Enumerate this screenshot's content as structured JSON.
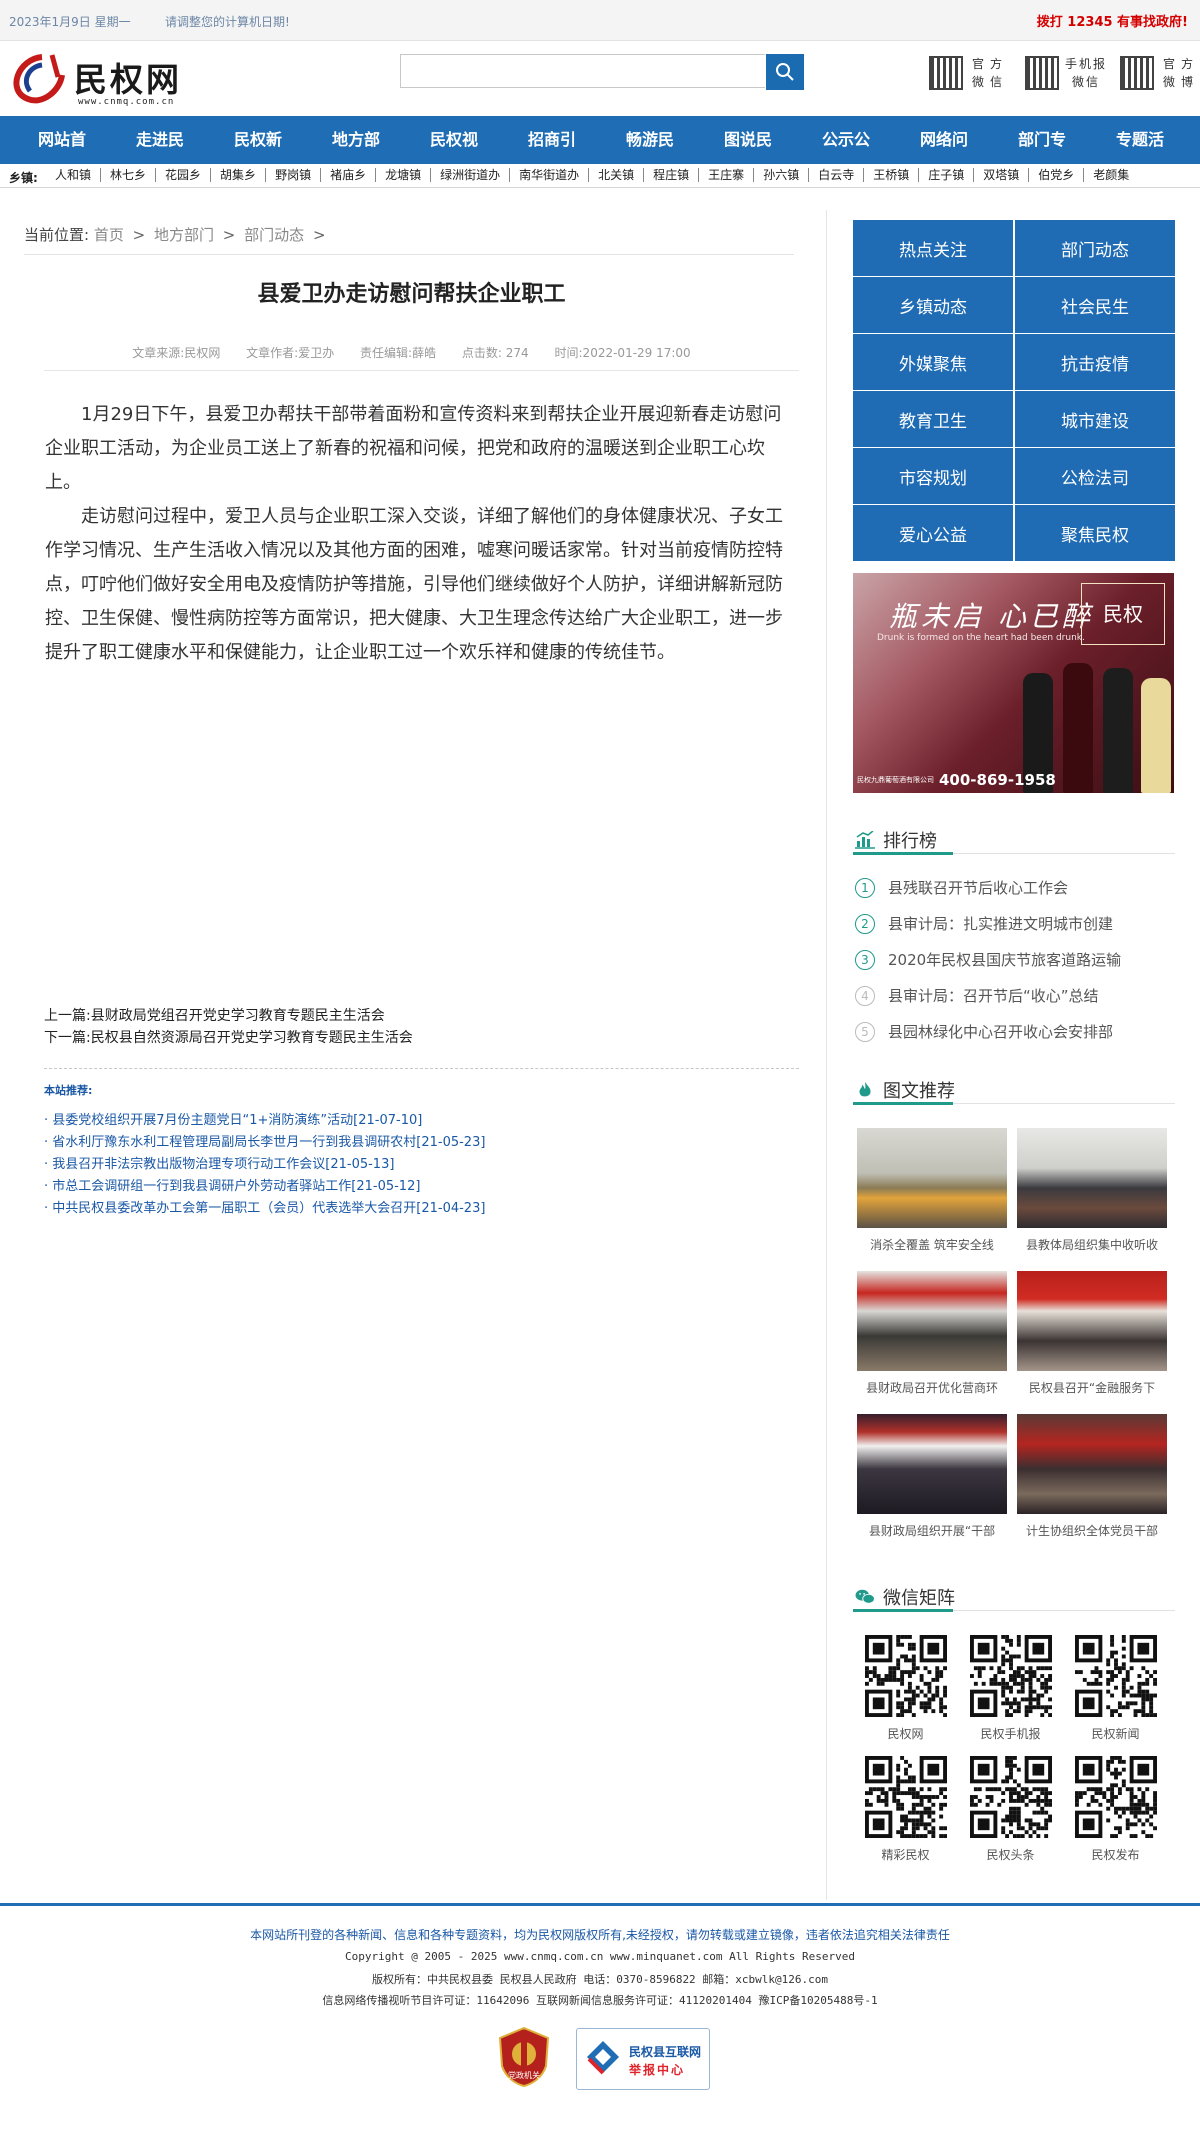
{
  "topbar": {
    "date": "2023年1月9日  星期一",
    "notice": "请调整您的计算机日期!",
    "hotline": "拨打 12345 有事找政府!"
  },
  "header": {
    "logo_text": "民权网",
    "logo_url": "www.cnmq.com.cn",
    "search_placeholder": "",
    "qr_links": [
      {
        "label": "官方微信"
      },
      {
        "label": "手机报微信"
      },
      {
        "label": "官方微博"
      }
    ]
  },
  "nav": {
    "items": [
      "网站首页",
      "走进民权",
      "民权新闻",
      "地方部门",
      "民权视频",
      "招商引资",
      "畅游民权",
      "图说民权",
      "公示公告",
      "网络问政",
      "部门专栏",
      "专题活动"
    ]
  },
  "towns": {
    "label": "乡镇:",
    "items": [
      "人和镇",
      "林七乡",
      "花园乡",
      "胡集乡",
      "野岗镇",
      "褚庙乡",
      "龙塘镇",
      "绿洲街道办",
      "南华街道办",
      "北关镇",
      "程庄镇",
      "王庄寨",
      "孙六镇",
      "白云寺",
      "王桥镇",
      "庄子镇",
      "双塔镇",
      "伯党乡",
      "老颜集"
    ]
  },
  "article": {
    "crumb": {
      "label": "当前位置:",
      "items": [
        "首页",
        "地方部门",
        "部门动态"
      ],
      "sep": ">"
    },
    "title": "县爱卫办走访慰问帮扶企业职工",
    "meta": {
      "source": "文章来源:民权网",
      "author": "文章作者:爱卫办",
      "editor": "责任编辑:薛皓",
      "hits": "点击数: 274",
      "time": "时间:2022-01-29 17:00"
    },
    "paragraphs": [
      "1月29日下午，县爱卫办帮扶干部带着面粉和宣传资料来到帮扶企业开展迎新春走访慰问企业职工活动，为企业员工送上了新春的祝福和问候，把党和政府的温暖送到企业职工心坎上。",
      "走访慰问过程中，爱卫人员与企业职工深入交谈，详细了解他们的身体健康状况、子女工作学习情况、生产生活收入情况以及其他方面的困难，嘘寒问暖话家常。针对当前疫情防控特点，叮咛他们做好安全用电及疫情防护等措施，引导他们继续做好个人防护，详细讲解新冠防控、卫生保健、慢性病防控等方面常识，把大健康、大卫生理念传达给广大企业职工，进一步提升了职工健康水平和保健能力，让企业职工过一个欢乐祥和健康的传统佳节。"
    ],
    "prev_label": "上一篇:",
    "prev": "县财政局党组召开党史学习教育专题民主生活会",
    "next_label": "下一篇:",
    "next": "民权县自然资源局召开党史学习教育专题民主生活会",
    "recommend_head": "本站推荐:",
    "recommend": [
      "· 县委党校组织开展7月份主题党日“1+消防演练”活动[21-07-10]",
      "· 省水利厅豫东水利工程管理局副局长李世月一行到我县调研农村[21-05-23]",
      "· 我县召开非法宗教出版物治理专项行动工作会议[21-05-13]",
      "· 市总工会调研组一行到我县调研户外劳动者驿站工作[21-05-12]",
      "· 中共民权县委改革办工会第一届职工（会员）代表选举大会召开[21-04-23]"
    ]
  },
  "sidebar": {
    "categories": [
      "热点关注",
      "部门动态",
      "乡镇动态",
      "社会民生",
      "外媒聚焦",
      "抗击疫情",
      "教育卫生",
      "城市建设",
      "市容规划",
      "公检法司",
      "爱心公益",
      "聚焦民权"
    ],
    "ad": {
      "slogan": "瓶未启  心已醉",
      "sub": "Drunk is formed on the heart had been drunk.",
      "brand": "民权",
      "phone": "400-869-1958",
      "company": "民权九鼎葡萄酒有限公司"
    },
    "rank_title": "排行榜",
    "rank": [
      {
        "num": "1",
        "text": "县残联召开节后收心工作会"
      },
      {
        "num": "2",
        "text": "县审计局：扎实推进文明城市创建"
      },
      {
        "num": "3",
        "text": "2020年民权县国庆节旅客道路运输"
      },
      {
        "num": "4",
        "text": "县审计局：召开节后“收心”总结"
      },
      {
        "num": "5",
        "text": "县园林绿化中心召开收心会安排部"
      }
    ],
    "photo_title": "图文推荐",
    "photos": [
      {
        "caption": "消杀全覆盖 筑牢安全线"
      },
      {
        "caption": "县教体局组织集中收听收"
      },
      {
        "caption": "县财政局召开优化营商环"
      },
      {
        "caption": "民权县召开“金融服务下"
      },
      {
        "caption": "县财政局组织开展“干部"
      },
      {
        "caption": "计生协组织全体党员干部"
      }
    ],
    "wx_title": "微信矩阵",
    "wx": [
      {
        "caption": "民权网"
      },
      {
        "caption": "民权手机报"
      },
      {
        "caption": "民权新闻"
      },
      {
        "caption": "精彩民权"
      },
      {
        "caption": "民权头条"
      },
      {
        "caption": "民权发布"
      }
    ]
  },
  "footer": {
    "line1": "本网站所刊登的各种新闻、信息和各种专题资料，均为民权网版权所有,未经授权，请勿转载或建立镜像，违者依法追究相关法律责任",
    "line2": "Copyright @ 2005 - 2025 www.cnmq.com.cn www.minquanet.com All Rights Reserved",
    "line3": "版权所有：中共民权县委 民权县人民政府 电话：0370-8596822 邮箱：xcbwlk@126.com",
    "line4": "信息网络传播视听节目许可证：11642096 互联网新闻信息服务许可证：41120201404 豫ICP备10205488号-1",
    "badge1": "党政机关",
    "badge2_title": "民权县互联网",
    "badge2_sub": "举报中心"
  },
  "colors": {
    "nav_blue": "#1e6db5",
    "accent_teal": "#1f9a8b",
    "link_blue": "#1a58a6",
    "hotline_red": "#d40000"
  }
}
